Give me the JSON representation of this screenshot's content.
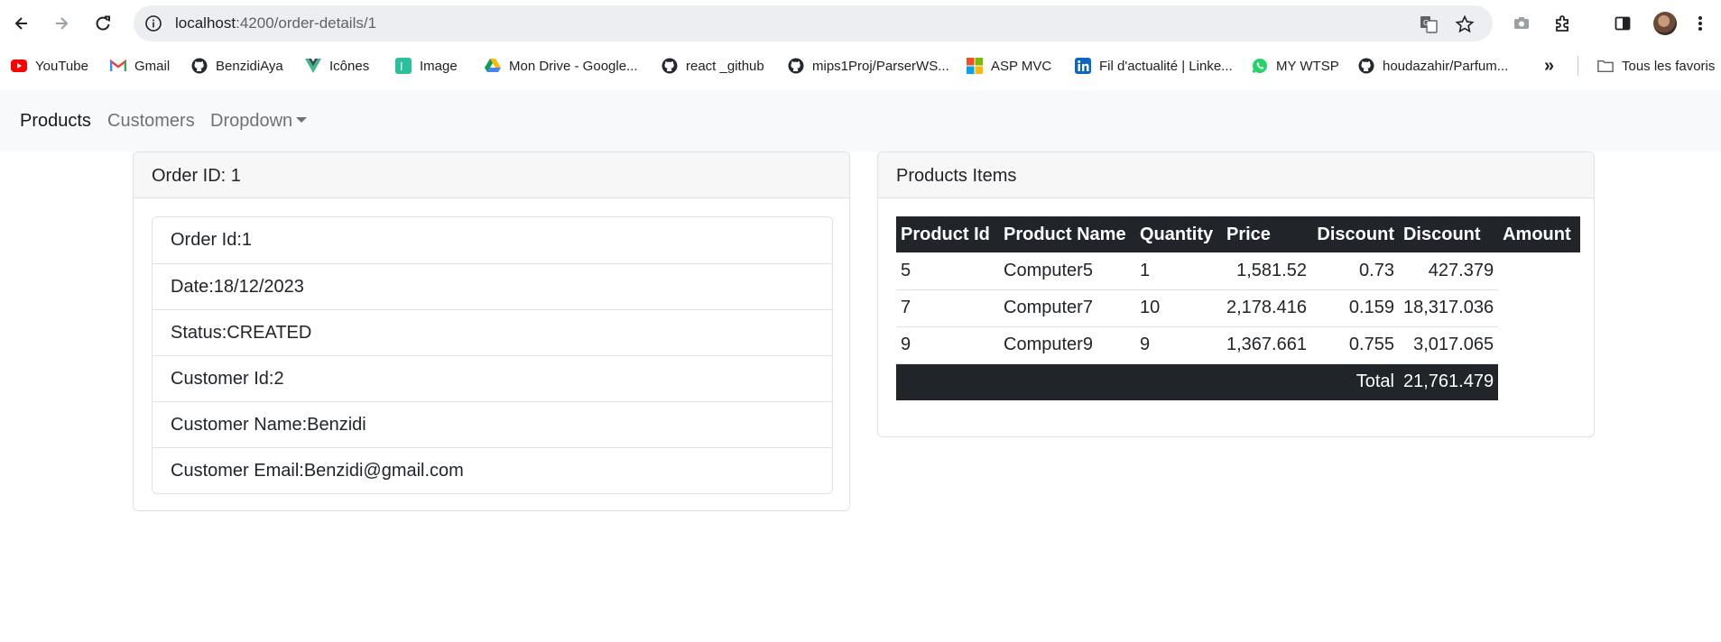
{
  "browser": {
    "url_host": "localhost",
    "url_path": ":4200/order-details/1",
    "icons": [
      "back-icon",
      "forward-icon",
      "reload-icon",
      "site-info-icon",
      "translate-icon",
      "star-icon",
      "camera-icon",
      "extensions-icon",
      "side-panel-icon",
      "profile-avatar",
      "menu-icon"
    ]
  },
  "bookmarks": {
    "items": [
      {
        "label": "YouTube",
        "icon": "youtube-icon",
        "color": "#ff0000"
      },
      {
        "label": "Gmail",
        "icon": "gmail-icon",
        "color": "#ea4335"
      },
      {
        "label": "BenzidiAya",
        "icon": "github-icon",
        "color": "#24292f"
      },
      {
        "label": "Icônes",
        "icon": "vue-icon",
        "color": "#41b883"
      },
      {
        "label": "Image",
        "icon": "image-icon",
        "color": "#2bbf9b"
      },
      {
        "label": "Mon Drive - Google...",
        "icon": "drive-icon",
        "color": "#1fa463"
      },
      {
        "label": "react _github",
        "icon": "github-icon",
        "color": "#24292f"
      },
      {
        "label": "mips1Proj/ParserWS...",
        "icon": "github-icon",
        "color": "#24292f"
      },
      {
        "label": "ASP MVC",
        "icon": "microsoft-icon",
        "color": "#f25022"
      },
      {
        "label": "Fil d'actualité | Linke...",
        "icon": "linkedin-icon",
        "color": "#0a66c2"
      },
      {
        "label": "MY WTSP",
        "icon": "whatsapp-icon",
        "color": "#25d366"
      },
      {
        "label": "houdazahir/Parfum...",
        "icon": "github-icon",
        "color": "#24292f"
      }
    ],
    "overflow": "»",
    "all_bookmarks": "Tous les favoris"
  },
  "navbar": {
    "products": "Products",
    "customers": "Customers",
    "dropdown": "Dropdown"
  },
  "order_card": {
    "header": "Order ID: 1",
    "items": [
      "Order Id:1",
      "Date:18/12/2023",
      "Status:CREATED",
      "Customer Id:2",
      "Customer Name:Benzidi",
      "Customer Email:Benzidi@gmail.com"
    ]
  },
  "products_card": {
    "header": "Products Items",
    "columns": [
      "Product Id",
      "Product Name",
      "Quantity",
      "Price",
      "Discount",
      "Discount",
      "Amount"
    ],
    "rows": [
      [
        "5",
        "Computer5",
        "1",
        "1,581.52",
        "0.73",
        "427.379"
      ],
      [
        "7",
        "Computer7",
        "10",
        "2,178.416",
        "0.159",
        "18,317.036"
      ],
      [
        "9",
        "Computer9",
        "9",
        "1,367.661",
        "0.755",
        "3,017.065"
      ]
    ],
    "total_label": "Total",
    "total_value": "21,761.479"
  },
  "colors": {
    "navbar_bg": "#f8f9fa",
    "table_dark": "#212529",
    "card_border": "#dee2e6"
  }
}
